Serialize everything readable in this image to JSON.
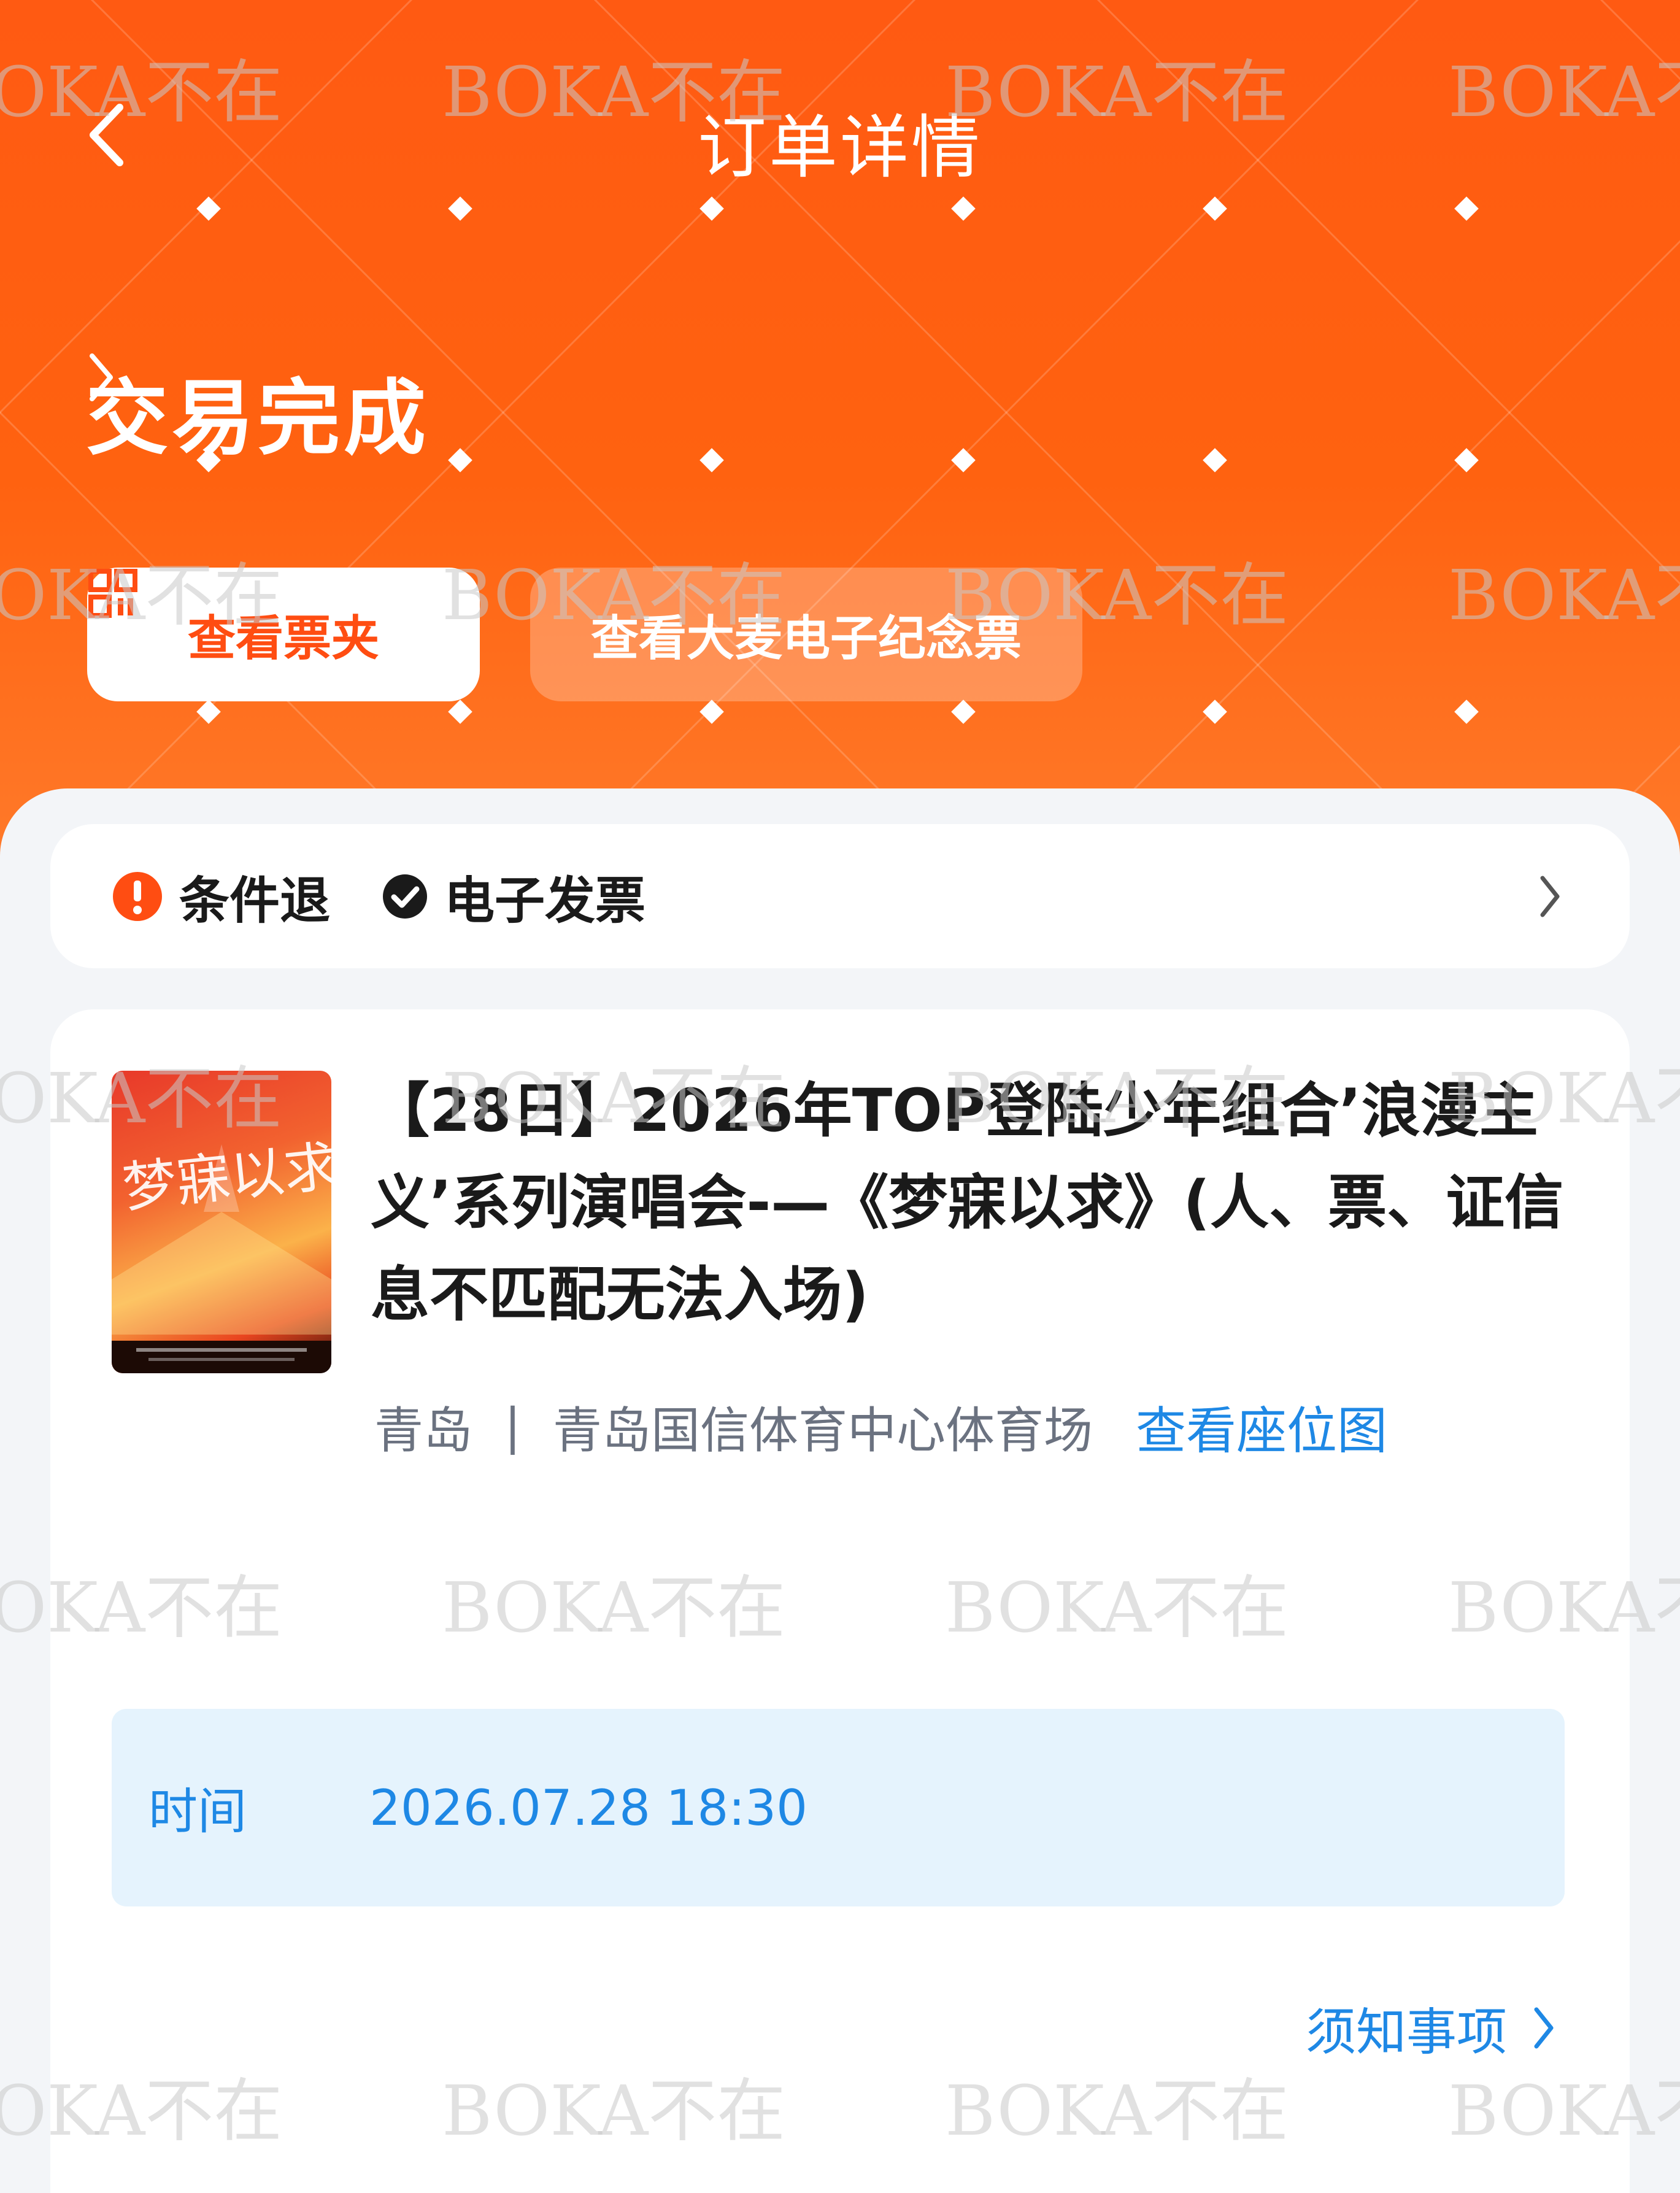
{
  "header": {
    "title": "订单详情",
    "status": "交易完成",
    "buttons": {
      "ticket_wallet": "查看票夹",
      "souvenir_ticket": "查看大麦电子纪念票"
    }
  },
  "service_tags": [
    {
      "label": "条件退",
      "icon": "alert-circle-icon"
    },
    {
      "label": "电子发票",
      "icon": "check-circle-icon"
    }
  ],
  "event": {
    "title": "【28日】2026年TOP登陆少年组合’浪漫主义’系列演唱会-—《梦寐以求》(人、票、证信息不匹配无法入场)",
    "city": "青岛",
    "venue": "青岛国信体育中心体育场",
    "seat_map_link": "查看座位图",
    "poster_title": "梦寐以求"
  },
  "time": {
    "label": "时间",
    "value": "2026.07.28 18:30"
  },
  "notice_link": "须知事项",
  "watermark_text": "BOKA不在",
  "colors": {
    "brand_orange": "#ff5a12",
    "link_blue": "#1e88e5",
    "time_box_bg": "#e5f3fd",
    "warning": "#ff4d12"
  }
}
